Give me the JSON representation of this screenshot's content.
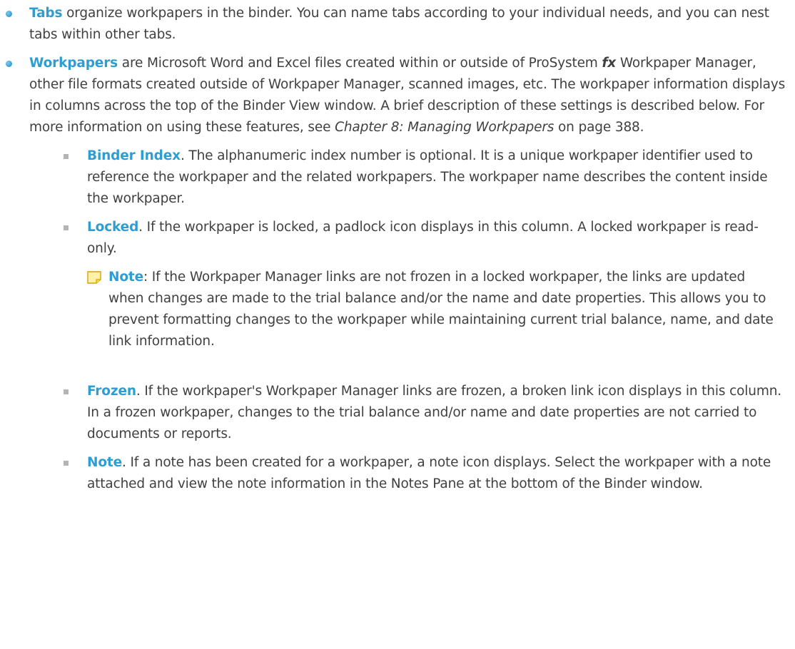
{
  "tabs_item": {
    "term": "Tabs",
    "text": " organize workpapers in the binder. You can name tabs according to your individual needs, and you can nest tabs within other tabs."
  },
  "workpapers_item": {
    "term": "Workpapers",
    "text_1": " are Microsoft Word and Excel files created within or outside of ProSystem ",
    "fx": "fx",
    "text_2": " Workpaper Manager, other file formats created outside of Workpaper Manager, scanned images, etc. The workpaper information displays in columns across the top of the Binder View window. A brief description of these settings is described below. For more information on using these features, see ",
    "chapter_ref": "Chapter 8: Managing Workpapers",
    "text_3": " on page 388."
  },
  "binder_index_item": {
    "term": "Binder Index",
    "text": ". The alphanumeric index number is optional. It is a unique workpaper identifier used to reference the workpaper and the related workpapers. The workpaper name describes the content inside the workpaper."
  },
  "locked_item": {
    "term": "Locked",
    "text": ". If the workpaper is locked, a padlock icon displays in this column. A locked workpaper is read-only."
  },
  "note_block": {
    "term": "Note",
    "text": ": If the Workpaper Manager links are not frozen in a locked workpaper, the links are updated when changes are made to the trial balance and/or the name and date properties. This allows you to prevent formatting changes to the workpaper while maintaining current trial balance, name, and date link information."
  },
  "frozen_item": {
    "term": "Frozen",
    "text": ". If the workpaper's Workpaper Manager links are frozen, a broken link icon displays in this column. In a frozen workpaper, changes to the trial balance and/or name and date properties are not carried to documents or reports."
  },
  "note_item": {
    "term": "Note",
    "text": ". If a note has been created for a workpaper, a note icon displays. Select the workpaper with a note attached and view the note information in the Notes Pane at the bottom of the Binder window."
  },
  "colors": {
    "term_blue": "#2e9ed2",
    "body_text": "#404040",
    "sub_bullet_gray": "#b4b4b4",
    "note_icon_yellow": "#fff2a8"
  }
}
